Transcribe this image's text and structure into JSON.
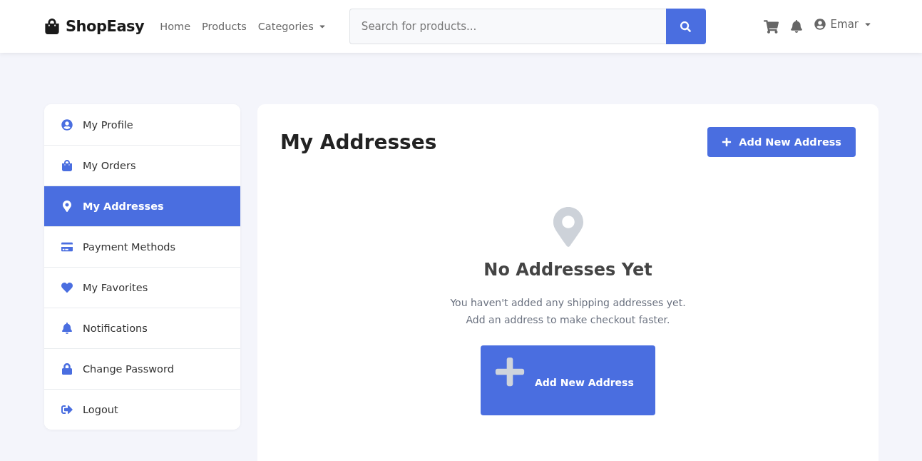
{
  "navbar": {
    "brand": "ShopEasy",
    "links": [
      {
        "label": "Home",
        "dropdown": false
      },
      {
        "label": "Products",
        "dropdown": false
      },
      {
        "label": "Categories",
        "dropdown": true
      }
    ],
    "search": {
      "placeholder": "Search for products..."
    },
    "user": "Emar"
  },
  "sidebar": {
    "items": [
      {
        "label": "My Profile",
        "kind": "profile",
        "selected": false
      },
      {
        "label": "My Orders",
        "kind": "orders",
        "selected": false
      },
      {
        "label": "My Addresses",
        "kind": "addresses",
        "selected": true
      },
      {
        "label": "Payment Methods",
        "kind": "payment",
        "selected": false
      },
      {
        "label": "My Favorites",
        "kind": "favorites",
        "selected": false
      },
      {
        "label": "Notifications",
        "kind": "notifications",
        "selected": false
      },
      {
        "label": "Change Password",
        "kind": "password",
        "selected": false
      },
      {
        "label": "Logout",
        "kind": "logout",
        "selected": false
      }
    ]
  },
  "main": {
    "title": "My Addresses",
    "header_button": "Add New Address",
    "empty_state": {
      "title": "No Addresses Yet",
      "lines": [
        "You haven't added any shipping addresses yet.",
        "Add an address to make checkout faster."
      ],
      "button": "Add New Address"
    }
  }
}
